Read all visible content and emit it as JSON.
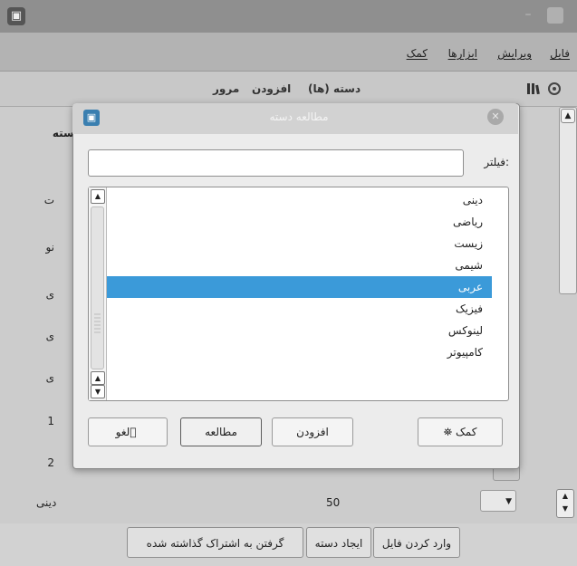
{
  "window": {
    "title": "",
    "icon": "app-icon"
  },
  "menubar": {
    "file": "فایل",
    "edit": "ویرایش",
    "tools": "ابزارها",
    "help": "کمک"
  },
  "toolbar": {
    "categories": "دسته (ها)",
    "add": "افزودن",
    "browse": "مرور",
    "icons": [
      "library-icon",
      "settings-icon"
    ]
  },
  "background": {
    "header_label": "دسته",
    "row_fragments": [
      "ت",
      "نو",
      "ی",
      "ی",
      "ی",
      "1",
      "2"
    ],
    "last_row": {
      "category": "دینی",
      "count": "50"
    }
  },
  "dialog": {
    "title": "مطالعه دسته",
    "filter_label": "فیلتر:",
    "filter_value": "",
    "items": [
      "دینی",
      "ریاضی",
      "زیست",
      "شیمی",
      "عربی",
      "فیزیک",
      "لینوکس",
      "کامپیوتر"
    ],
    "selected_index": 4,
    "buttons": {
      "help": "کمک",
      "add": "افزودن",
      "study": "مطالعه",
      "cancel": "لغو"
    }
  },
  "bottom_buttons": {
    "import_file": "وارد کردن فایل",
    "create_category": "ایجاد دسته",
    "get_shared": "گرفتن به اشتراک گذاشته شده"
  },
  "colors": {
    "selection": "#3b9ad9",
    "window_bg": "#d7d7d7",
    "dialog_bg": "#ececec"
  }
}
